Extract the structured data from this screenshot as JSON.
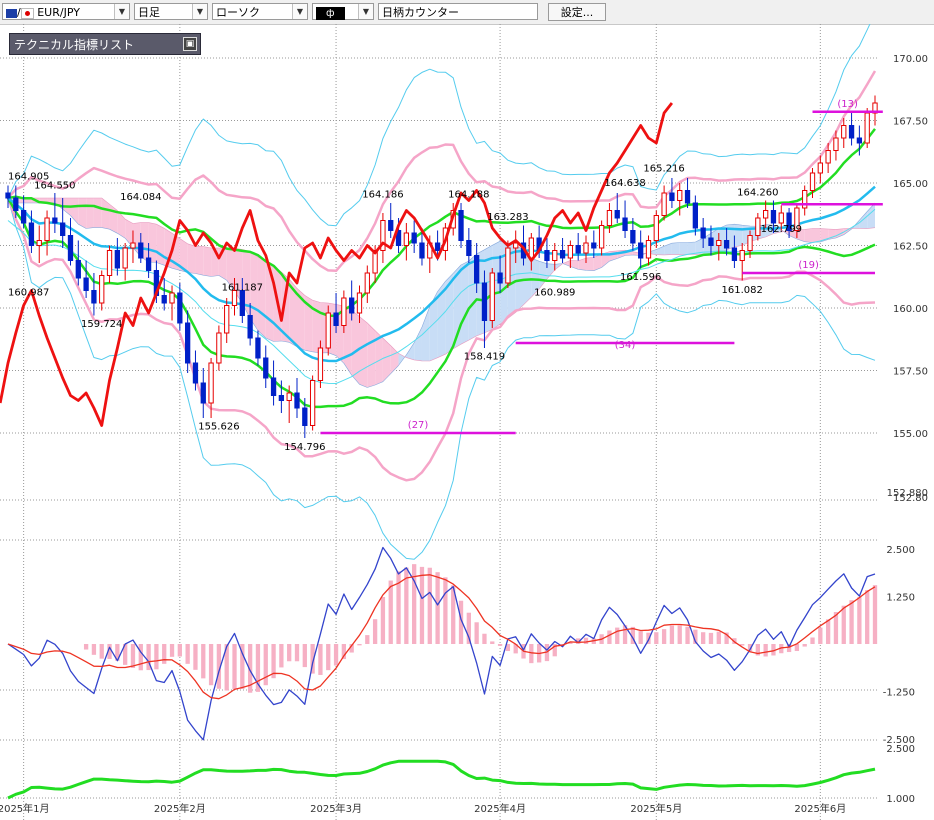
{
  "toolbar": {
    "symbol": "EUR/JPY",
    "symbol_prefix": "/",
    "timeframe": "日足",
    "chart_type": "ローソク",
    "draw_tool": "ф",
    "counter": "日柄カウンター",
    "settings_label": "設定..."
  },
  "tech_panel": {
    "title": "テクニカル指標リスト",
    "close_glyph": "▣"
  },
  "colors": {
    "up_candle": "#e60000",
    "down_candle": "#0020c8",
    "price_line_red": "#ee1111",
    "ma_green": "#22dd22",
    "ma_cyan": "#22bbee",
    "bollinger_pink": "#f5a5c8",
    "bollinger_outer": "#55ccee",
    "cloud_pink": "#f9c6dc",
    "cloud_blue": "#c8ddf6",
    "count_line": "#dd11dd",
    "macd_blue": "#3344cc",
    "signal_red": "#ee3322",
    "hist_pink": "#f6b0c4",
    "lower_green": "#22dd22"
  },
  "chart_data": {
    "type": "candlestick",
    "main_axis": {
      "ylim": [
        152.8,
        171.0
      ],
      "ticks": [
        "170.00",
        "167.50",
        "165.00",
        "162.50",
        "160.00",
        "157.50",
        "155.00"
      ],
      "tick_values": [
        170.0,
        167.5,
        165.0,
        162.5,
        160.0,
        157.5,
        155.0
      ],
      "bottom_labels": [
        "152.880",
        "152.80"
      ]
    },
    "x_axis": {
      "labels": [
        "2025年1月",
        "2025年2月",
        "2025年3月",
        "2025年4月",
        "2025年5月",
        "2025年6月"
      ],
      "label_index": [
        2,
        22,
        42,
        63,
        83,
        104
      ]
    },
    "candles": [
      [
        164.6,
        164.9,
        164.0,
        164.4
      ],
      [
        164.4,
        164.9,
        163.6,
        163.9
      ],
      [
        163.9,
        164.5,
        163.2,
        163.4
      ],
      [
        163.4,
        163.9,
        162.2,
        162.5
      ],
      [
        162.5,
        163.3,
        161.8,
        162.7
      ],
      [
        162.7,
        163.9,
        162.1,
        163.6
      ],
      [
        163.6,
        164.6,
        163.0,
        163.4
      ],
      [
        163.4,
        164.4,
        162.4,
        162.9
      ],
      [
        162.9,
        163.6,
        161.7,
        161.9
      ],
      [
        161.9,
        162.7,
        160.9,
        161.2
      ],
      [
        161.2,
        161.9,
        160.4,
        160.7
      ],
      [
        160.7,
        161.4,
        159.7,
        160.2
      ],
      [
        160.2,
        161.5,
        159.9,
        161.3
      ],
      [
        161.3,
        162.5,
        161.0,
        162.3
      ],
      [
        162.3,
        162.8,
        161.3,
        161.6
      ],
      [
        161.6,
        162.6,
        161.1,
        162.4
      ],
      [
        162.4,
        163.1,
        161.8,
        162.6
      ],
      [
        162.6,
        163.0,
        161.8,
        162.0
      ],
      [
        162.0,
        162.6,
        161.2,
        161.5
      ],
      [
        161.5,
        161.9,
        160.2,
        160.5
      ],
      [
        160.5,
        161.2,
        159.9,
        160.2
      ],
      [
        160.2,
        160.9,
        159.5,
        160.6
      ],
      [
        160.6,
        161.0,
        159.1,
        159.4
      ],
      [
        159.4,
        159.9,
        157.4,
        157.8
      ],
      [
        157.8,
        158.3,
        156.7,
        157.0
      ],
      [
        157.0,
        157.6,
        155.6,
        156.2
      ],
      [
        156.2,
        158.0,
        155.6,
        157.8
      ],
      [
        157.8,
        159.3,
        157.5,
        159.0
      ],
      [
        159.0,
        160.4,
        158.6,
        160.1
      ],
      [
        160.1,
        161.2,
        159.7,
        160.7
      ],
      [
        160.7,
        161.2,
        159.4,
        159.7
      ],
      [
        159.7,
        160.2,
        158.5,
        158.8
      ],
      [
        158.8,
        159.1,
        157.7,
        158.0
      ],
      [
        158.0,
        158.5,
        156.8,
        157.2
      ],
      [
        157.2,
        157.9,
        156.1,
        156.5
      ],
      [
        156.5,
        157.1,
        155.8,
        156.3
      ],
      [
        156.3,
        156.9,
        155.4,
        156.6
      ],
      [
        156.6,
        157.2,
        155.6,
        156.0
      ],
      [
        156.0,
        156.4,
        154.8,
        155.3
      ],
      [
        155.3,
        157.3,
        155.1,
        157.1
      ],
      [
        157.1,
        158.7,
        156.8,
        158.4
      ],
      [
        158.4,
        160.1,
        158.1,
        159.8
      ],
      [
        159.8,
        160.6,
        159.0,
        159.3
      ],
      [
        159.3,
        160.7,
        159.0,
        160.4
      ],
      [
        160.4,
        161.1,
        159.5,
        159.8
      ],
      [
        159.8,
        160.9,
        159.4,
        160.6
      ],
      [
        160.6,
        161.7,
        160.2,
        161.4
      ],
      [
        161.4,
        162.5,
        161.0,
        162.3
      ],
      [
        162.3,
        163.8,
        161.8,
        163.5
      ],
      [
        163.5,
        164.2,
        162.8,
        163.1
      ],
      [
        163.1,
        163.6,
        162.2,
        162.5
      ],
      [
        162.5,
        163.4,
        161.9,
        163.0
      ],
      [
        163.0,
        163.5,
        162.2,
        162.6
      ],
      [
        162.6,
        163.2,
        161.7,
        162.0
      ],
      [
        162.0,
        162.9,
        161.4,
        162.6
      ],
      [
        162.6,
        163.1,
        161.9,
        162.3
      ],
      [
        162.3,
        163.4,
        161.9,
        163.2
      ],
      [
        163.2,
        164.2,
        162.9,
        163.9
      ],
      [
        163.9,
        164.2,
        162.4,
        162.7
      ],
      [
        162.7,
        163.2,
        161.8,
        162.1
      ],
      [
        162.1,
        162.6,
        160.6,
        161.0
      ],
      [
        161.0,
        161.5,
        158.4,
        159.5
      ],
      [
        159.5,
        161.6,
        159.2,
        161.4
      ],
      [
        161.4,
        162.1,
        160.6,
        161.0
      ],
      [
        161.0,
        162.7,
        160.8,
        162.4
      ],
      [
        162.4,
        163.1,
        161.8,
        162.6
      ],
      [
        162.6,
        163.3,
        161.7,
        162.0
      ],
      [
        162.0,
        163.0,
        161.5,
        162.8
      ],
      [
        162.8,
        163.3,
        162.0,
        162.3
      ],
      [
        162.3,
        162.8,
        161.6,
        161.9
      ],
      [
        161.9,
        162.6,
        161.5,
        162.3
      ],
      [
        162.3,
        162.8,
        161.8,
        162.0
      ],
      [
        162.0,
        162.7,
        161.6,
        162.5
      ],
      [
        162.5,
        163.0,
        161.9,
        162.2
      ],
      [
        162.2,
        162.9,
        161.8,
        162.6
      ],
      [
        162.6,
        163.1,
        162.0,
        162.4
      ],
      [
        162.4,
        163.5,
        162.1,
        163.3
      ],
      [
        163.3,
        164.2,
        163.0,
        163.9
      ],
      [
        163.9,
        164.6,
        163.4,
        163.6
      ],
      [
        163.6,
        164.3,
        162.8,
        163.1
      ],
      [
        163.1,
        163.6,
        162.3,
        162.6
      ],
      [
        162.6,
        163.1,
        161.6,
        162.0
      ],
      [
        162.0,
        162.9,
        161.7,
        162.7
      ],
      [
        162.7,
        163.9,
        162.4,
        163.7
      ],
      [
        163.7,
        164.9,
        163.5,
        164.6
      ],
      [
        164.6,
        165.2,
        164.0,
        164.3
      ],
      [
        164.3,
        165.0,
        163.7,
        164.7
      ],
      [
        164.7,
        165.2,
        164.0,
        164.2
      ],
      [
        164.2,
        164.5,
        162.9,
        163.2
      ],
      [
        163.2,
        163.6,
        162.4,
        162.8
      ],
      [
        162.8,
        163.3,
        162.1,
        162.5
      ],
      [
        162.5,
        163.0,
        161.9,
        162.7
      ],
      [
        162.7,
        163.2,
        162.1,
        162.4
      ],
      [
        162.4,
        162.9,
        161.6,
        161.9
      ],
      [
        161.9,
        162.6,
        161.1,
        162.3
      ],
      [
        162.3,
        163.1,
        162.0,
        162.9
      ],
      [
        162.9,
        163.8,
        162.7,
        163.6
      ],
      [
        163.6,
        164.3,
        163.2,
        163.9
      ],
      [
        163.9,
        164.3,
        163.0,
        163.4
      ],
      [
        163.4,
        164.1,
        163.1,
        163.8
      ],
      [
        163.8,
        164.0,
        162.8,
        163.1
      ],
      [
        163.1,
        164.2,
        162.8,
        164.0
      ],
      [
        164.0,
        164.9,
        163.7,
        164.7
      ],
      [
        164.7,
        165.6,
        164.4,
        165.4
      ],
      [
        165.4,
        166.1,
        165.0,
        165.8
      ],
      [
        165.8,
        166.6,
        165.4,
        166.3
      ],
      [
        166.3,
        167.1,
        165.9,
        166.8
      ],
      [
        166.8,
        167.6,
        166.4,
        167.3
      ],
      [
        167.3,
        167.8,
        166.5,
        166.8
      ],
      [
        166.8,
        167.3,
        166.1,
        166.6
      ],
      [
        166.6,
        168.0,
        166.4,
        167.8
      ],
      [
        167.8,
        168.5,
        167.3,
        168.2
      ]
    ],
    "price_labels": [
      "164.905",
      "164.550",
      "164.084",
      "160.987",
      "159.724",
      "161.187",
      "155.626",
      "154.796",
      "164.186",
      "164.188",
      "163.283",
      "158.419",
      "160.989",
      "165.216",
      "164.638",
      "161.596",
      "164.260",
      "162.799",
      "161.082"
    ],
    "count_labels": [
      "(27)",
      "(34)",
      "(13)",
      "(19)"
    ],
    "sub1_axis": {
      "ticks": [
        "2.500",
        "1.250",
        "-1.250",
        "-2.500"
      ],
      "tick_values": [
        2.5,
        1.25,
        -1.25,
        -2.5
      ],
      "ylim": [
        -2.7,
        2.7
      ]
    },
    "sub2_axis": {
      "ticks": [
        "2.500",
        "1.000"
      ],
      "tick_values": [
        2.5,
        1.0
      ],
      "ylim": [
        0.9,
        2.6
      ]
    }
  }
}
